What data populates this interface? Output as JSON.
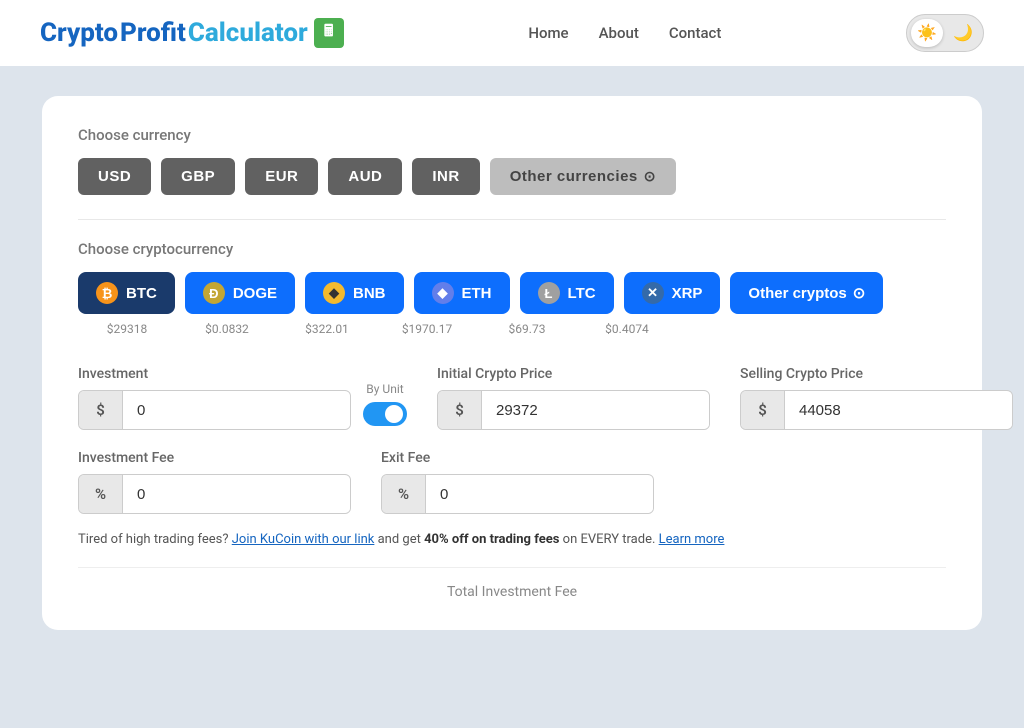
{
  "header": {
    "logo_crypto": "Crypto",
    "logo_profit": "Profit",
    "logo_calculator": "Calculator",
    "logo_icon": "🖩",
    "nav": {
      "home": "Home",
      "about": "About",
      "contact": "Contact"
    },
    "theme": {
      "light_icon": "☀️",
      "dark_icon": "🌙"
    }
  },
  "currency": {
    "section_label": "Choose currency",
    "buttons": [
      "USD",
      "GBP",
      "EUR",
      "AUD",
      "INR"
    ],
    "other_label": "Other currencies",
    "other_chevron": "⊙"
  },
  "cryptocurrency": {
    "section_label": "Choose cryptocurrency",
    "coins": [
      {
        "id": "btc",
        "label": "BTC",
        "icon": "₿",
        "icon_class": "icon-btc",
        "price": "$29318",
        "selected": true
      },
      {
        "id": "doge",
        "label": "DOGE",
        "icon": "Ð",
        "icon_class": "icon-doge",
        "price": "$0.0832",
        "selected": false
      },
      {
        "id": "bnb",
        "label": "BNB",
        "icon": "◆",
        "icon_class": "icon-bnb",
        "price": "$322.01",
        "selected": false
      },
      {
        "id": "eth",
        "label": "ETH",
        "icon": "♦",
        "icon_class": "icon-eth",
        "price": "$1970.17",
        "selected": false
      },
      {
        "id": "ltc",
        "label": "LTC",
        "icon": "Ł",
        "icon_class": "icon-ltc",
        "price": "$69.73",
        "selected": false
      },
      {
        "id": "xrp",
        "label": "XRP",
        "icon": "✕",
        "icon_class": "icon-xrp",
        "price": "$0.4074",
        "selected": false
      }
    ],
    "other_label": "Other cryptos",
    "other_chevron": "⊙"
  },
  "form": {
    "investment": {
      "label": "Investment",
      "toggle_label": "By Unit",
      "prefix": "$",
      "value": "0",
      "placeholder": "0"
    },
    "initial_price": {
      "label": "Initial Crypto Price",
      "prefix": "$",
      "value": "29372",
      "placeholder": "29372"
    },
    "selling_price": {
      "label": "Selling Crypto Price",
      "prefix": "$",
      "value": "44058",
      "placeholder": "44058"
    },
    "investment_fee": {
      "label": "Investment Fee",
      "prefix": "%",
      "value": "0",
      "placeholder": "0"
    },
    "exit_fee": {
      "label": "Exit Fee",
      "prefix": "%",
      "value": "0",
      "placeholder": "0"
    }
  },
  "promo": {
    "text_before": "Tired of high trading fees?",
    "link_text": "Join KuCoin with our link",
    "text_middle": "and get",
    "bold_text": "40% off on trading fees",
    "text_after": "on EVERY trade.",
    "learn_more": "Learn more"
  },
  "total": {
    "label": "Total Investment Fee"
  }
}
